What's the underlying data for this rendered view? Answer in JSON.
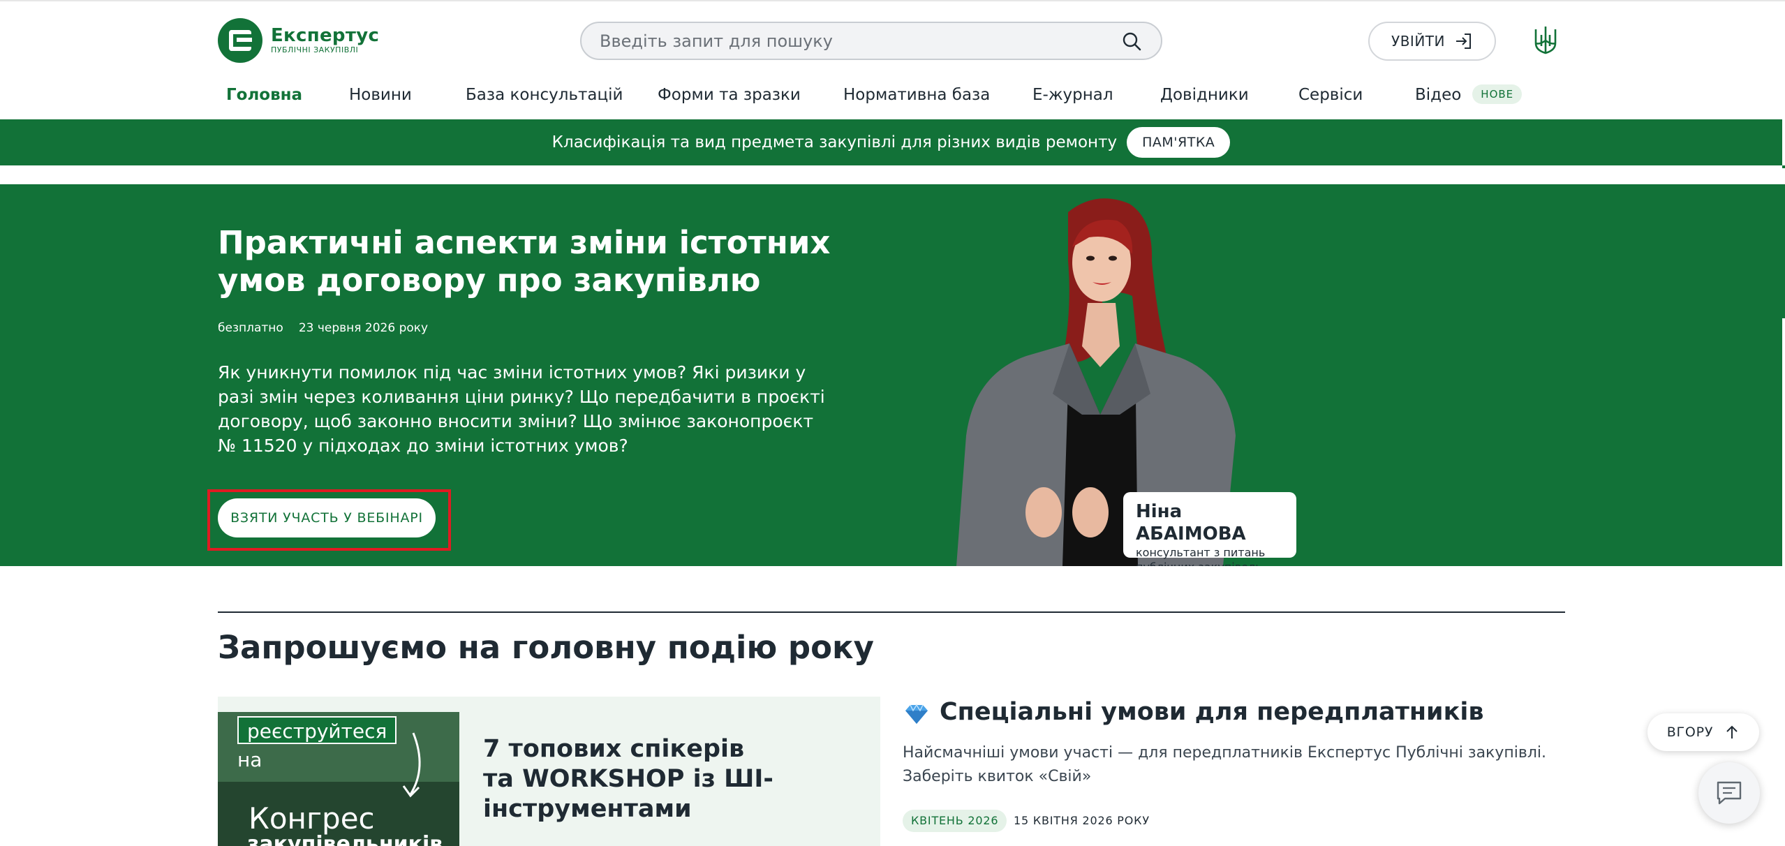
{
  "header": {
    "logo": {
      "name": "Експертус",
      "subtitle": "ПУБЛІЧНІ ЗАКУПІВЛІ"
    },
    "search": {
      "placeholder": "Введіть запит для пошуку",
      "icon": "search-icon"
    },
    "login_label": "УВІЙТИ"
  },
  "nav": {
    "items": [
      {
        "label": "Головна",
        "active": true
      },
      {
        "label": "Новини"
      },
      {
        "label": "База консультацій"
      },
      {
        "label": "Форми та зразки"
      },
      {
        "label": "Нормативна база"
      },
      {
        "label": "Е-журнал"
      },
      {
        "label": "Довідники"
      },
      {
        "label": "Сервіси"
      },
      {
        "label": "Відео",
        "badge": "НОВЕ"
      }
    ]
  },
  "announcement": {
    "text": "Класифікація та вид предмета закупівлі для різних видів ремонту",
    "button": "ПАМ'ЯТКА"
  },
  "hero": {
    "title": "Практичні аспекти зміни істотних умов договору про закупівлю",
    "price": "безплатно",
    "date": "23 червня 2026 року",
    "description": "Як уникнути помилок під час зміни істотних умов? Які ризики у разі змін через коливання ціни ринку? Що передбачити в проєкті договору, щоб законно вносити зміни? Що змінює законопроєкт № 11520 у підходах до зміни істотних умов?",
    "cta": "ВЗЯТИ УЧАСТЬ У ВЕБІНАРІ",
    "speaker": {
      "name": "Ніна АБАІМОВА",
      "role_line1": "консультант з питань",
      "role_line2": "публічних закупівель"
    }
  },
  "section": {
    "title": "Запрошуємо на головну подію року",
    "event": {
      "image_tag": "реєструйтеся",
      "image_line1": "на",
      "image_line2": "Конгрес",
      "image_line3": "закупівельників",
      "title": "7 топових спікерів та WORKSHOP із ШІ-інструментами"
    },
    "promo": {
      "icon": "diamond-icon",
      "title": "Спеціальні умови для передплатників",
      "text": "Найсмачніші умови участі — для передплатників Експертус Публічні закупівлі. Заберіть квиток «Свій»",
      "tag": "КВІТЕНЬ 2026",
      "date": "15 КВІТНЯ 2026 РОКУ"
    }
  },
  "floating": {
    "to_top": "ВГОРУ",
    "chat_icon": "chat-icon"
  },
  "colors": {
    "brand": "#127238",
    "highlight": "#e01b22",
    "badge_bg": "#e5f2e8"
  }
}
